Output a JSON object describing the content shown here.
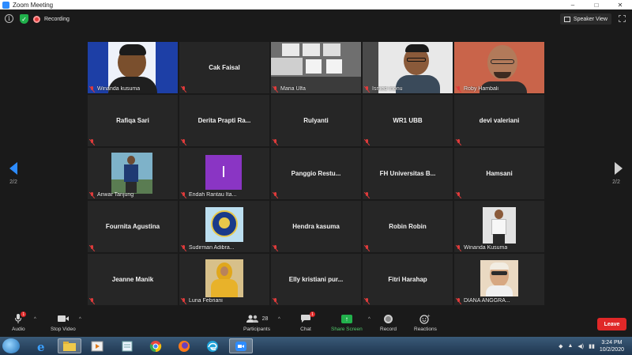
{
  "window": {
    "title": "Zoom Meeting",
    "controls": [
      "–",
      "□",
      "✕"
    ]
  },
  "topbar": {
    "recording_label": "Recording",
    "speaker_view_label": "Speaker View"
  },
  "pagination": {
    "left": "2/2",
    "right": "2/2"
  },
  "tiles": [
    {
      "name": "Winanda kusuma",
      "type": "video",
      "scene": "banner"
    },
    {
      "name": "Cak Faisal",
      "type": "name"
    },
    {
      "name": "Maria Ulfa",
      "type": "video",
      "scene": "window"
    },
    {
      "name": "Ismed Inonu",
      "type": "video",
      "scene": "man-glasses"
    },
    {
      "name": "Roby Hambali",
      "type": "video",
      "scene": "man-bald",
      "active": true
    },
    {
      "name": "Rafiqa Sari",
      "type": "name"
    },
    {
      "name": "Derita Prapti Ra...",
      "type": "name"
    },
    {
      "name": "Rulyanti",
      "type": "name"
    },
    {
      "name": "WR1 UBB",
      "type": "name"
    },
    {
      "name": "devi valeriani",
      "type": "name"
    },
    {
      "name": "Anwar Tanjung",
      "type": "photo",
      "scene": "standing"
    },
    {
      "name": "Endah Rantau Ita...",
      "type": "letter",
      "letter": "I"
    },
    {
      "name": "Panggio  Restu...",
      "type": "name"
    },
    {
      "name": "FH Universitas B...",
      "type": "name"
    },
    {
      "name": "Hamsani",
      "type": "name"
    },
    {
      "name": "Fournita Agustina",
      "type": "name"
    },
    {
      "name": "Sudirman Adibra...",
      "type": "photo",
      "scene": "logo"
    },
    {
      "name": "Hendra kasuma",
      "type": "name"
    },
    {
      "name": "Robin Robin",
      "type": "name"
    },
    {
      "name": "Winanda Kusuma",
      "type": "photo",
      "scene": "portrait"
    },
    {
      "name": "Jeanne Manik",
      "type": "name"
    },
    {
      "name": "Luna Febriani",
      "type": "photo",
      "scene": "hijab"
    },
    {
      "name": "Elly  kristiani pur...",
      "type": "name"
    },
    {
      "name": "Fitri Harahap",
      "type": "name"
    },
    {
      "name": "DIANA ANGGRA...",
      "type": "photo",
      "scene": "selfie"
    }
  ],
  "tile_labels": {
    "1": "Cak Faisal",
    "5": "Rafiqa Sari",
    "6": "Derita Prapti Ra...",
    "7": "Rulyanti",
    "8": "WR1 UBB",
    "9": "devi valeriani",
    "12": "Panggio  Restu...",
    "13": "FH Universitas B...",
    "14": "Hamsani",
    "15": "Fournita Agustina",
    "17": "Hendra kasuma",
    "18": "Robin Robin",
    "20": "Jeanne Manik",
    "22": "Elly  kristiani pur...",
    "23": "Fitri Harahap"
  },
  "toolbar": {
    "audio": "Audio",
    "audio_badge": "1",
    "stop_video": "Stop Video",
    "participants": "Participants",
    "participants_count": "28",
    "chat": "Chat",
    "chat_badge": "1",
    "share_screen": "Share Screen",
    "record": "Record",
    "reactions": "Reactions",
    "leave": "Leave"
  },
  "taskbar": {
    "time": "3:24 PM",
    "date": "10/2/2020",
    "apps": [
      "internet-explorer",
      "file-explorer",
      "media-player",
      "notepad",
      "chrome",
      "firefox",
      "edge",
      "zoom"
    ]
  },
  "colors": {
    "accent": "#2d8cff",
    "active_border": "#d7e84b",
    "share": "#22b14c",
    "leave": "#e02828",
    "mute": "#e03b3b"
  }
}
